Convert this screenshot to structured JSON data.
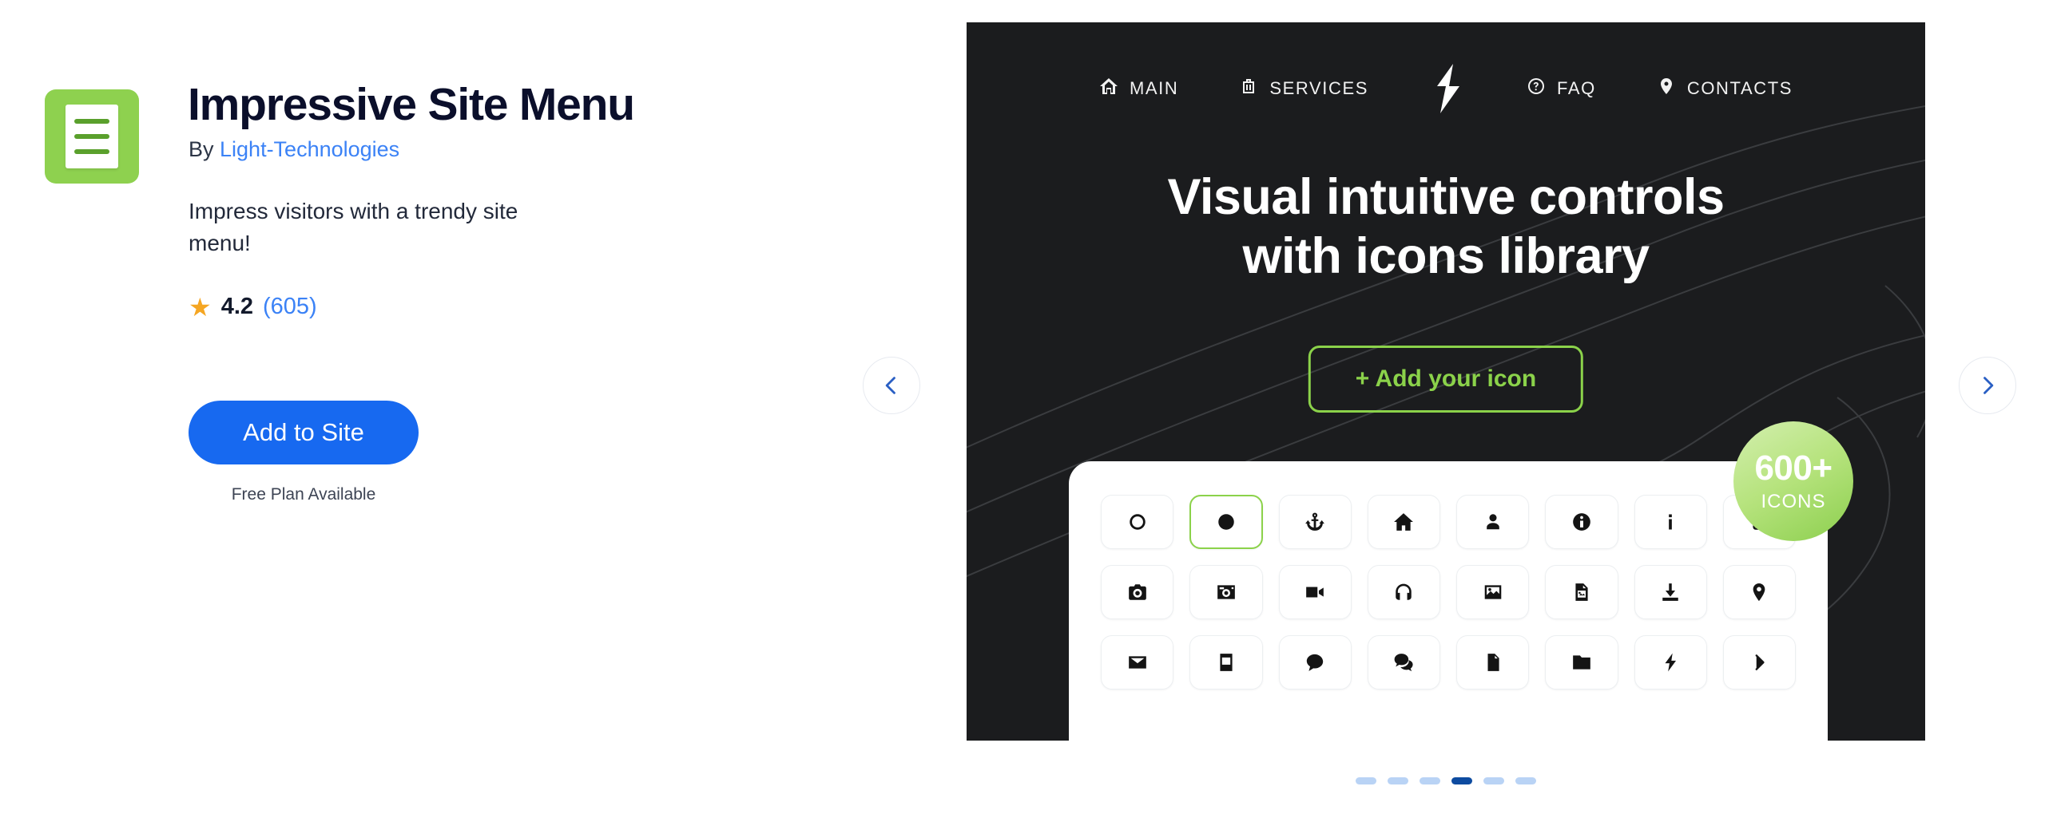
{
  "app": {
    "logo_icon": "hamburger-menu-document-icon",
    "title": "Impressive Site Menu",
    "by_label": "By ",
    "vendor": "Light-Technologies",
    "description": "Impress visitors with a trendy site menu!",
    "rating": {
      "star_icon": "star-icon",
      "score": "4.2",
      "reviews_count": "(605)"
    },
    "cta_label": "Add to Site",
    "plan_note": "Free Plan Available",
    "colors": {
      "logo_green": "#8ed14f",
      "cta_blue": "#1769f0",
      "link_blue": "#3b82f6",
      "star_amber": "#f5a623"
    }
  },
  "promo": {
    "background": "#1b1c1e",
    "accent_green": "#8bd24a",
    "nav": [
      {
        "icon": "home-icon",
        "label": "MAIN"
      },
      {
        "icon": "briefcase-icon",
        "label": "SERVICES"
      },
      {
        "icon": "bolt-logo-icon",
        "label": ""
      },
      {
        "icon": "question-circle-icon",
        "label": "FAQ"
      },
      {
        "icon": "map-pin-icon",
        "label": "CONTACTS"
      }
    ],
    "headline_line1": "Visual intuitive controls",
    "headline_line2": "with icons library",
    "add_icon_label": "+ Add your icon",
    "badge": {
      "count": "600+",
      "label": "ICONS"
    },
    "icon_grid": [
      {
        "name": "circle-outline-icon",
        "selected": false
      },
      {
        "name": "circle-filled-icon",
        "selected": true
      },
      {
        "name": "anchor-icon",
        "selected": false
      },
      {
        "name": "home-icon",
        "selected": false
      },
      {
        "name": "user-icon",
        "selected": false
      },
      {
        "name": "info-circle-icon",
        "selected": false
      },
      {
        "name": "info-letter-icon",
        "selected": false
      },
      {
        "name": "book-icon",
        "selected": false
      },
      {
        "name": "camera-icon",
        "selected": false
      },
      {
        "name": "camera-retro-icon",
        "selected": false
      },
      {
        "name": "video-camera-icon",
        "selected": false
      },
      {
        "name": "headphones-icon",
        "selected": false
      },
      {
        "name": "image-icon",
        "selected": false
      },
      {
        "name": "image-file-icon",
        "selected": false
      },
      {
        "name": "download-icon",
        "selected": false
      },
      {
        "name": "map-marker-icon",
        "selected": false
      },
      {
        "name": "envelope-icon",
        "selected": false
      },
      {
        "name": "inbox-icon",
        "selected": false
      },
      {
        "name": "comment-icon",
        "selected": false
      },
      {
        "name": "comments-icon",
        "selected": false
      },
      {
        "name": "file-icon",
        "selected": false
      },
      {
        "name": "folder-icon",
        "selected": false
      },
      {
        "name": "bolt-icon",
        "selected": false
      },
      {
        "name": "chevron-right-icon",
        "selected": false
      }
    ]
  },
  "carousel": {
    "prev_icon": "chevron-left-icon",
    "next_icon": "chevron-right-icon",
    "total_slides": 6,
    "active_slide": 4
  }
}
